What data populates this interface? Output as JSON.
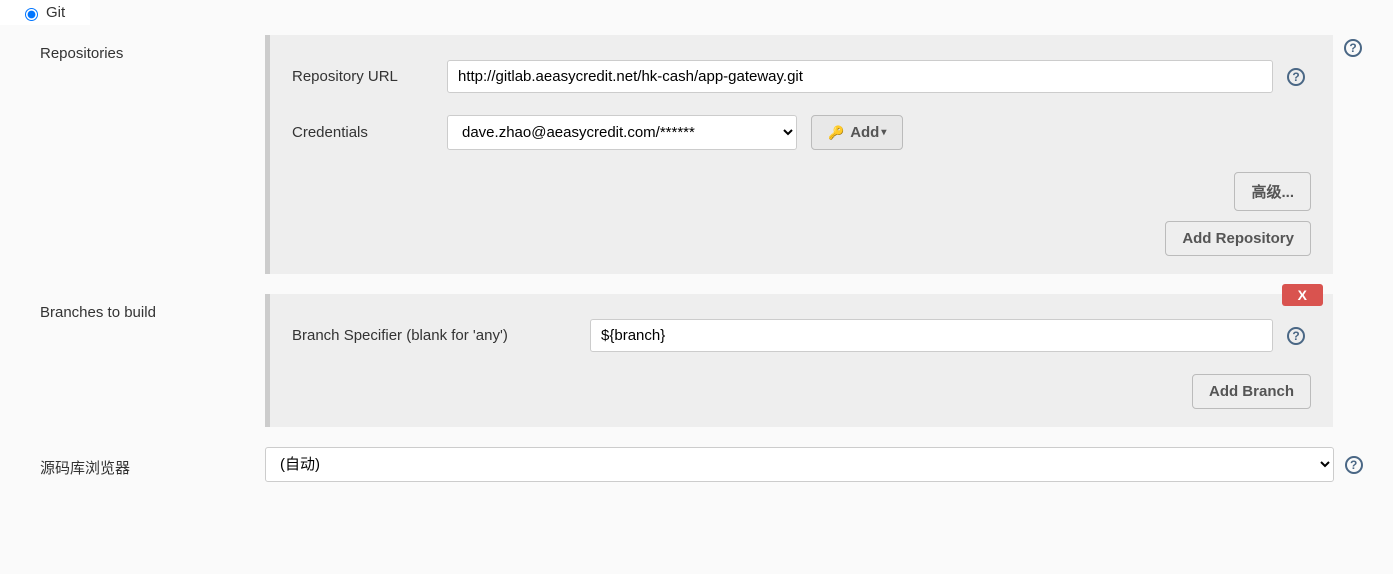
{
  "scm": {
    "selected_label": "Git"
  },
  "repositories": {
    "section_label": "Repositories",
    "url_label": "Repository URL",
    "url_value": "http://gitlab.aeasycredit.net/hk-cash/app-gateway.git",
    "credentials_label": "Credentials",
    "credentials_selected": "dave.zhao@aeasycredit.com/******",
    "add_cred_label": "Add",
    "advanced_label": "高级...",
    "add_repo_label": "Add Repository"
  },
  "branches": {
    "section_label": "Branches to build",
    "specifier_label": "Branch Specifier (blank for 'any')",
    "specifier_value": "${branch}",
    "delete_label": "X",
    "add_branch_label": "Add Branch"
  },
  "browser": {
    "section_label": "源码库浏览器",
    "selected": "(自动)"
  }
}
